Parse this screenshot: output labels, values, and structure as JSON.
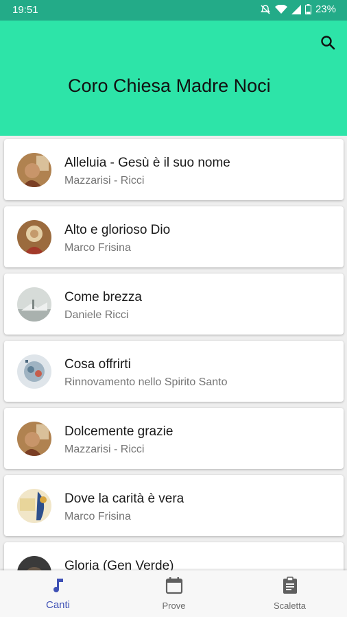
{
  "status_bar": {
    "time": "19:51",
    "battery": "23%"
  },
  "app_bar": {
    "title": "Coro Chiesa Madre Noci"
  },
  "songs": [
    {
      "title": "Alleluia - Gesù è il suo nome",
      "author": "Mazzarisi - Ricci"
    },
    {
      "title": "Alto e glorioso Dio",
      "author": "Marco Frisina"
    },
    {
      "title": "Come brezza",
      "author": "Daniele Ricci"
    },
    {
      "title": "Cosa offrirti",
      "author": "Rinnovamento nello Spirito Santo"
    },
    {
      "title": "Dolcemente grazie",
      "author": "Mazzarisi - Ricci"
    },
    {
      "title": "Dove la carità è vera",
      "author": "Marco Frisina"
    },
    {
      "title": "Gloria (Gen Verde)",
      "author": ""
    }
  ],
  "bottom_nav": {
    "items": [
      {
        "label": "Canti",
        "icon": "music-note-icon",
        "active": true
      },
      {
        "label": "Prove",
        "icon": "calendar-icon",
        "active": false
      },
      {
        "label": "Scaletta",
        "icon": "clipboard-icon",
        "active": false
      }
    ]
  },
  "colors": {
    "app_bar": "#2de4a8",
    "status_bar": "#23ab88",
    "accent": "#3f51b5"
  }
}
